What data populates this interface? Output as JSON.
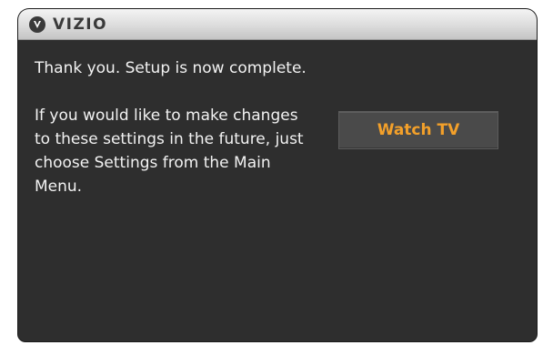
{
  "header": {
    "brand": "VIZIO",
    "logo_icon": "vizio-v-logo-icon"
  },
  "dialog": {
    "message_line1": "Thank you. Setup is now complete.",
    "message_line2": "If you would like to make changes to these settings in the future, just choose Settings from the Main Menu.",
    "watch_tv_label": "Watch TV"
  },
  "colors": {
    "panel_background": "#2e2e2e",
    "titlebar": "#dcdcdc",
    "button_background": "#4a4a4a",
    "button_text": "#f3a02a",
    "body_text": "#f2f2f2"
  }
}
